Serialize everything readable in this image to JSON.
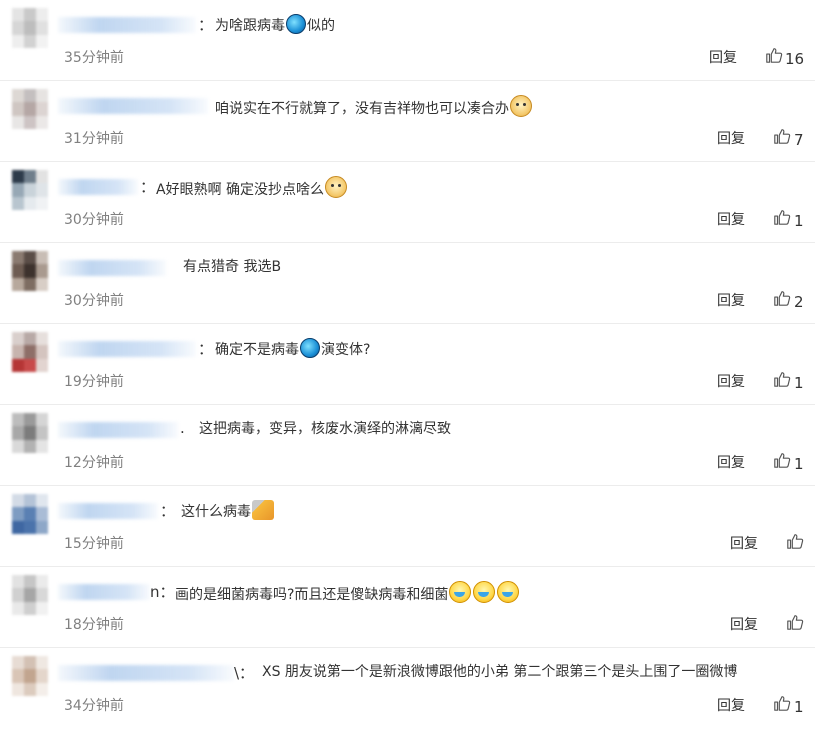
{
  "colors": {
    "text": "#333333",
    "time": "#808080",
    "divider": "#ececec",
    "name_blur": "#b4cdea"
  },
  "reply_label": "回复",
  "comments": [
    {
      "sep": "：",
      "text": "为啥跟病毒",
      "emoji": "virus-emoji",
      "text2": "似的",
      "time": "35分钟前",
      "likes": "16"
    },
    {
      "sep": "",
      "text": "咱说实在不行就算了，没有吉祥物也可以凑合办",
      "emoji": "doge-emoji",
      "text2": "",
      "time": "31分钟前",
      "likes": "7"
    },
    {
      "sep": "：",
      "text": "A好眼熟啊 确定没抄点啥么",
      "emoji": "doge-emoji",
      "text2": "",
      "time": "30分钟前",
      "likes": "1"
    },
    {
      "sep": "",
      "text": "有点猎奇 我选B",
      "emoji": "",
      "text2": "",
      "time": "30分钟前",
      "likes": "2"
    },
    {
      "sep": "：",
      "text": "确定不是病毒",
      "emoji": "virus-emoji",
      "text2": "演变体?",
      "time": "19分钟前",
      "likes": "1"
    },
    {
      "sep": ".",
      "text": "这把病毒，变异，核废水演绎的淋漓尽致",
      "emoji": "",
      "text2": "",
      "time": "12分钟前",
      "likes": "1"
    },
    {
      "sep": "：",
      "text": "这什么病毒",
      "emoji": "hammer-emoji",
      "text2": "",
      "time": "15分钟前",
      "likes": ""
    },
    {
      "sep": "n：",
      "text": "画的是细菌病毒吗?而且还是傻缺病毒和细菌",
      "emoji": "laugh-emoji",
      "text2": "",
      "time": "18分钟前",
      "likes": ""
    },
    {
      "sep": "\\：",
      "text": "XS 朋友说第一个是新浪微博跟他的小弟 第二个跟第三个是头上围了一圈微博",
      "emoji": "",
      "text2": "",
      "time": "34分钟前",
      "likes": "1"
    }
  ]
}
